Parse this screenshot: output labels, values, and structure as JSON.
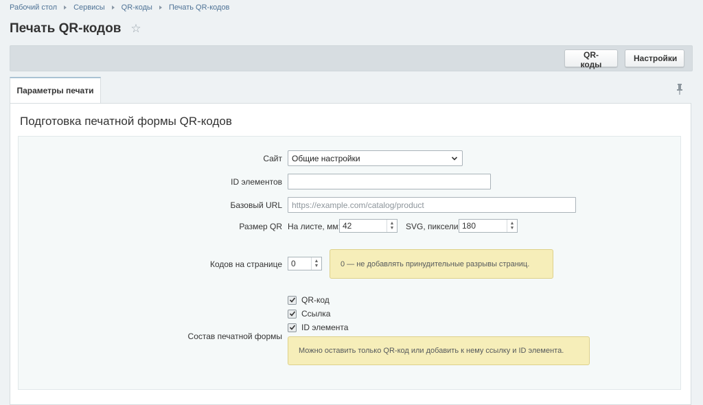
{
  "breadcrumb": [
    "Рабочий стол",
    "Сервисы",
    "QR-коды",
    "Печать QR-кодов"
  ],
  "page_title": "Печать QR-кодов",
  "toolbar": {
    "qr_codes_label": "QR-коды",
    "settings_label": "Настройки"
  },
  "tabs": [
    {
      "label": "Параметры печати",
      "active": true
    }
  ],
  "panel_title": "Подготовка печатной формы QR-кодов",
  "form": {
    "site": {
      "label": "Сайт",
      "value": "Общие настройки"
    },
    "element_ids": {
      "label": "ID элементов",
      "value": ""
    },
    "base_url": {
      "label": "Базовый URL",
      "placeholder": "https://example.com/catalog/product"
    },
    "qr_size": {
      "label": "Размер QR",
      "sheet_label": "На листе, мм:",
      "sheet_value": "42",
      "svg_label": "SVG, пиксели:",
      "svg_value": "180"
    },
    "codes_per_page": {
      "label": "Кодов на странице",
      "value": "0",
      "hint": "0 — не добавлять принудительные разрывы страниц."
    },
    "composition": {
      "label": "Состав печатной формы",
      "options": [
        {
          "label": "QR-код",
          "checked": true
        },
        {
          "label": "Ссылка",
          "checked": true
        },
        {
          "label": "ID элемента",
          "checked": true
        }
      ],
      "hint": "Можно оставить только QR-код или добавить к нему ссылку и ID элемента."
    }
  },
  "colors": {
    "link": "#4f7396",
    "hint_bg": "#f6eeb9",
    "toolbar_bg": "#d7dde1"
  }
}
